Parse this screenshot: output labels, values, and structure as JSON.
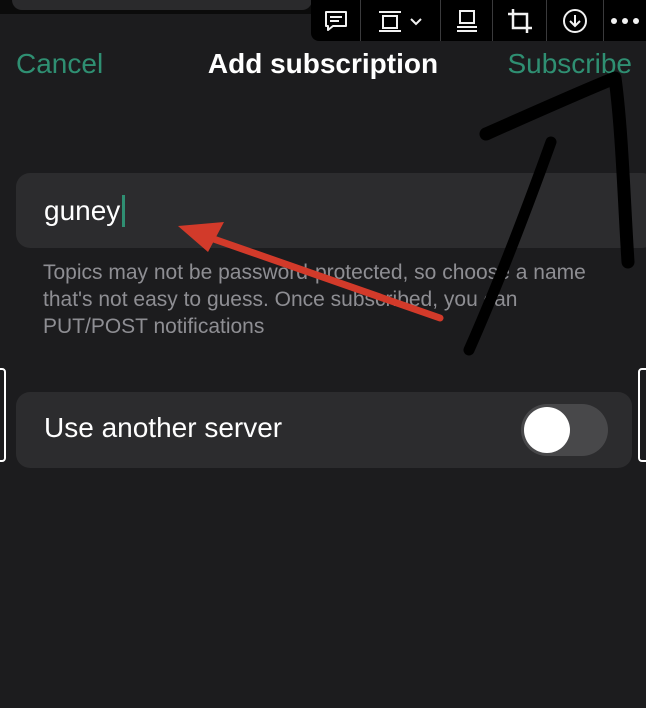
{
  "nav": {
    "cancel_label": "Cancel",
    "title": "Add subscription",
    "subscribe_label": "Subscribe"
  },
  "topic": {
    "value": "guney",
    "hint": "Topics may not be password-protected, so choose a name that's not easy to guess. Once subscribed, you can PUT/POST notifications"
  },
  "server": {
    "label": "Use another server",
    "toggle_on": false
  },
  "toolbar": {
    "items": [
      "comment-icon",
      "align-dropdown-icon",
      "layout-icon",
      "crop-icon",
      "download-icon",
      "more-icon"
    ]
  },
  "colors": {
    "accent": "#2f8f72",
    "background": "#1c1c1e",
    "field": "#2c2c2e",
    "hint_text": "#8e8e93",
    "arrow_red": "#d23a2a"
  }
}
